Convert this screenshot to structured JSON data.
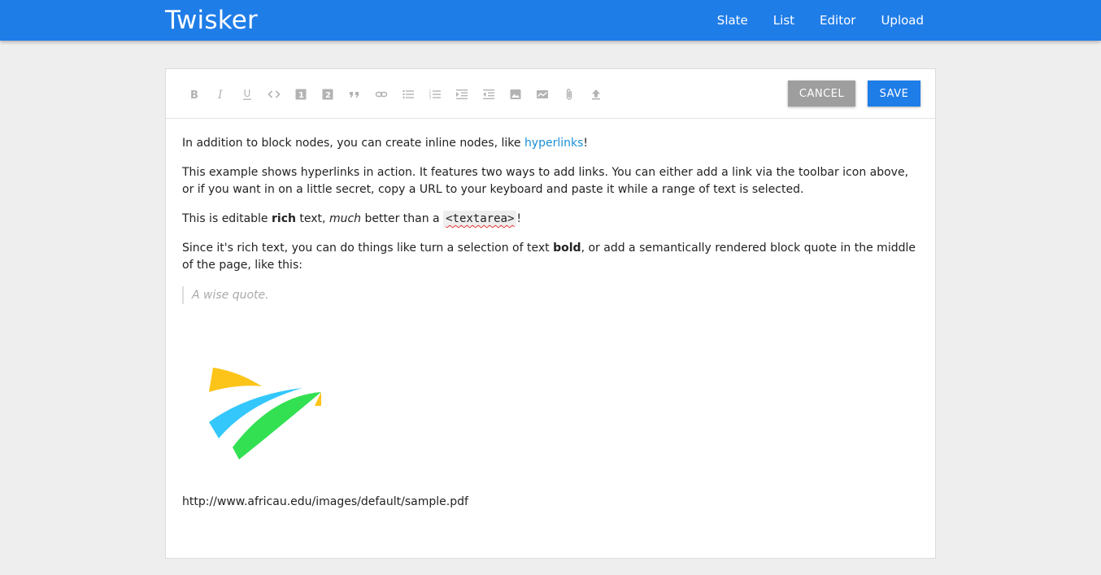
{
  "app": {
    "brand": "Twisker",
    "nav": [
      "Slate",
      "List",
      "Editor",
      "Upload"
    ]
  },
  "toolbar": {
    "tools": [
      {
        "name": "bold-icon",
        "glyph": "B"
      },
      {
        "name": "italic-icon",
        "glyph": "I"
      },
      {
        "name": "underline-icon",
        "glyph": "U"
      },
      {
        "name": "code-icon",
        "glyph": "<>"
      },
      {
        "name": "heading-one-icon",
        "glyph": "1"
      },
      {
        "name": "heading-two-icon",
        "glyph": "2"
      },
      {
        "name": "block-quote-icon",
        "glyph": "”"
      },
      {
        "name": "link-icon",
        "glyph": "link"
      },
      {
        "name": "bulleted-list-icon",
        "glyph": "ul"
      },
      {
        "name": "numbered-list-icon",
        "glyph": "ol"
      },
      {
        "name": "indent-icon",
        "glyph": "indent"
      },
      {
        "name": "outdent-icon",
        "glyph": "outdent"
      },
      {
        "name": "image-icon",
        "glyph": "image"
      },
      {
        "name": "photo-icon",
        "glyph": "photo"
      },
      {
        "name": "attachment-icon",
        "glyph": "clip"
      },
      {
        "name": "upload-icon",
        "glyph": "upload"
      }
    ],
    "cancel_label": "CANCEL",
    "save_label": "SAVE"
  },
  "editor": {
    "p1_text": "In addition to block nodes, you can create inline nodes, like ",
    "p1_link": "hyperlinks",
    "p1_end": "!",
    "p2": "This example shows hyperlinks in action. It features two ways to add links. You can either add a link via the toolbar icon above, or if you want in on a little secret, copy a URL to your keyboard and paste it while a range of text is selected.",
    "p3_a": "This is editable ",
    "p3_rich": "rich",
    "p3_b": " text, ",
    "p3_much": "much",
    "p3_c": " better than a ",
    "p3_code": "<textarea>",
    "p3_end": "!",
    "p4_a": "Since it's rich text, you can do things like turn a selection of text ",
    "p4_bold": "bold",
    "p4_b": ", or add a semantically rendered block quote in the middle of the page, like this:",
    "quote": "A wise quote.",
    "pdf_url": "http://www.africau.edu/images/default/sample.pdf"
  },
  "colors": {
    "appbar": "#1f7de8",
    "link": "#1a8fd6",
    "logo_yellow": "#fcc419",
    "logo_blue": "#33c7fb",
    "logo_green": "#33e052"
  }
}
